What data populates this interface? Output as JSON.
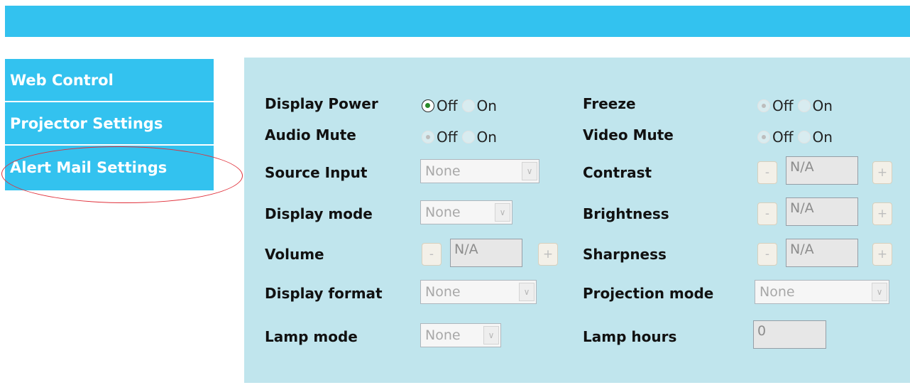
{
  "nav": {
    "items": [
      {
        "label": "Web Control"
      },
      {
        "label": "Projector Settings"
      },
      {
        "label": "Alert Mail Settings"
      }
    ]
  },
  "controls": {
    "display_power": {
      "label": "Display Power",
      "off": "Off",
      "on": "On",
      "selected": "Off"
    },
    "audio_mute": {
      "label": "Audio Mute",
      "off": "Off",
      "on": "On",
      "selected": "Off"
    },
    "source_input": {
      "label": "Source Input",
      "value": "None"
    },
    "display_mode": {
      "label": "Display mode",
      "value": "None"
    },
    "volume": {
      "label": "Volume",
      "minus": "-",
      "value": "N/A",
      "plus": "+"
    },
    "display_format": {
      "label": "Display format",
      "value": "None"
    },
    "lamp_mode": {
      "label": "Lamp mode",
      "value": "None"
    },
    "freeze": {
      "label": "Freeze",
      "off": "Off",
      "on": "On",
      "selected": "Off"
    },
    "video_mute": {
      "label": "Video Mute",
      "off": "Off",
      "on": "On",
      "selected": "Off"
    },
    "contrast": {
      "label": "Contrast",
      "minus": "-",
      "value": "N/A",
      "plus": "+"
    },
    "brightness": {
      "label": "Brightness",
      "minus": "-",
      "value": "N/A",
      "plus": "+"
    },
    "sharpness": {
      "label": "Sharpness",
      "minus": "-",
      "value": "N/A",
      "plus": "+"
    },
    "projection_mode": {
      "label": "Projection mode",
      "value": "None"
    },
    "lamp_hours": {
      "label": "Lamp hours",
      "value": "0"
    }
  },
  "colors": {
    "header_bar": "#33c2ef",
    "nav_bg": "#33c2ef",
    "panel_bg": "#c0e5ed",
    "highlight_ellipse": "#e0303a"
  },
  "icons": {
    "select_arrow": "chevron-down-icon"
  }
}
